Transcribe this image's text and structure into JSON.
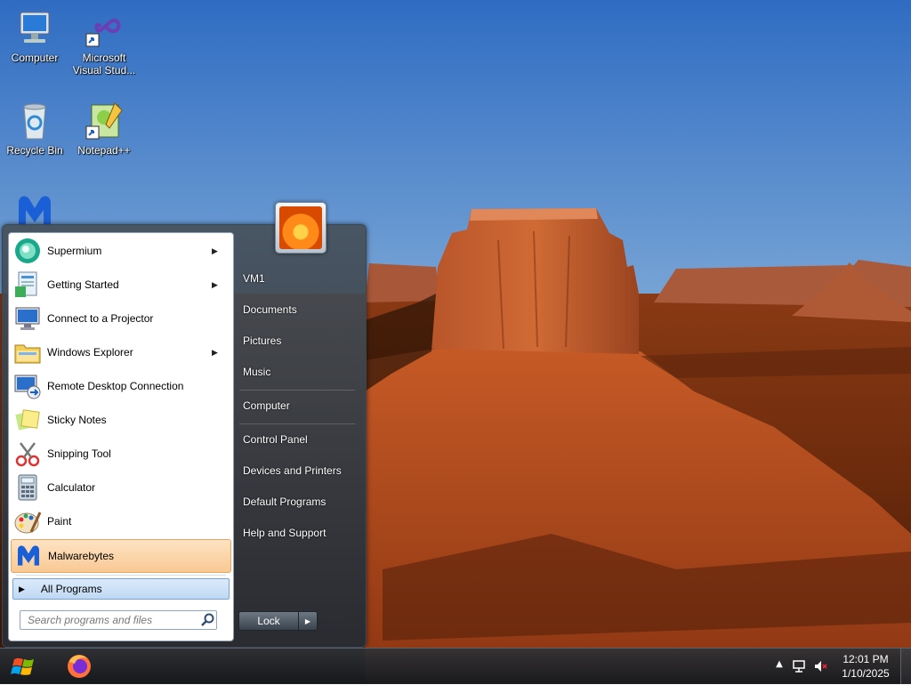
{
  "desktop": {
    "icons": [
      {
        "label": "Computer",
        "icon": "computer-icon"
      },
      {
        "label": "Microsoft Visual Stud...",
        "icon": "visual-studio-icon"
      },
      {
        "label": "Recycle Bin",
        "icon": "recycle-bin-icon"
      },
      {
        "label": "Notepad++",
        "icon": "notepad-plus-plus-icon"
      },
      {
        "label": "",
        "icon": "malwarebytes-icon"
      }
    ]
  },
  "start_menu": {
    "programs": [
      {
        "label": "Supermium",
        "icon": "supermium-icon",
        "has_submenu": true
      },
      {
        "label": "Getting Started",
        "icon": "getting-started-icon",
        "has_submenu": true
      },
      {
        "label": "Connect to a Projector",
        "icon": "projector-icon",
        "has_submenu": false
      },
      {
        "label": "Windows Explorer",
        "icon": "windows-explorer-icon",
        "has_submenu": true
      },
      {
        "label": "Remote Desktop Connection",
        "icon": "remote-desktop-icon",
        "has_submenu": false
      },
      {
        "label": "Sticky Notes",
        "icon": "sticky-notes-icon",
        "has_submenu": false
      },
      {
        "label": "Snipping Tool",
        "icon": "snipping-tool-icon",
        "has_submenu": false
      },
      {
        "label": "Calculator",
        "icon": "calculator-icon",
        "has_submenu": false
      },
      {
        "label": "Paint",
        "icon": "paint-icon",
        "has_submenu": false
      },
      {
        "label": "Malwarebytes",
        "icon": "malwarebytes-icon",
        "has_submenu": false,
        "highlighted": true
      }
    ],
    "all_programs_label": "All Programs",
    "search_placeholder": "Search programs and files",
    "right_items": {
      "user": "VM1",
      "documents": "Documents",
      "pictures": "Pictures",
      "music": "Music",
      "computer": "Computer",
      "control_panel": "Control Panel",
      "devices_printers": "Devices and Printers",
      "default_programs": "Default Programs",
      "help_support": "Help and Support"
    },
    "lock_label": "Lock"
  },
  "taskbar": {
    "pinned": [
      "start-orb-icon",
      "firefox-icon"
    ],
    "tray_icons": [
      "show-hidden-icons-arrow",
      "network-icon",
      "volume-muted-icon"
    ],
    "clock_time": "12:01 PM",
    "clock_date": "1/10/2025"
  },
  "colors": {
    "highlight": "#f9c994",
    "all_programs_bg": "#bfd9f3",
    "taskbar": "#1e2328"
  }
}
